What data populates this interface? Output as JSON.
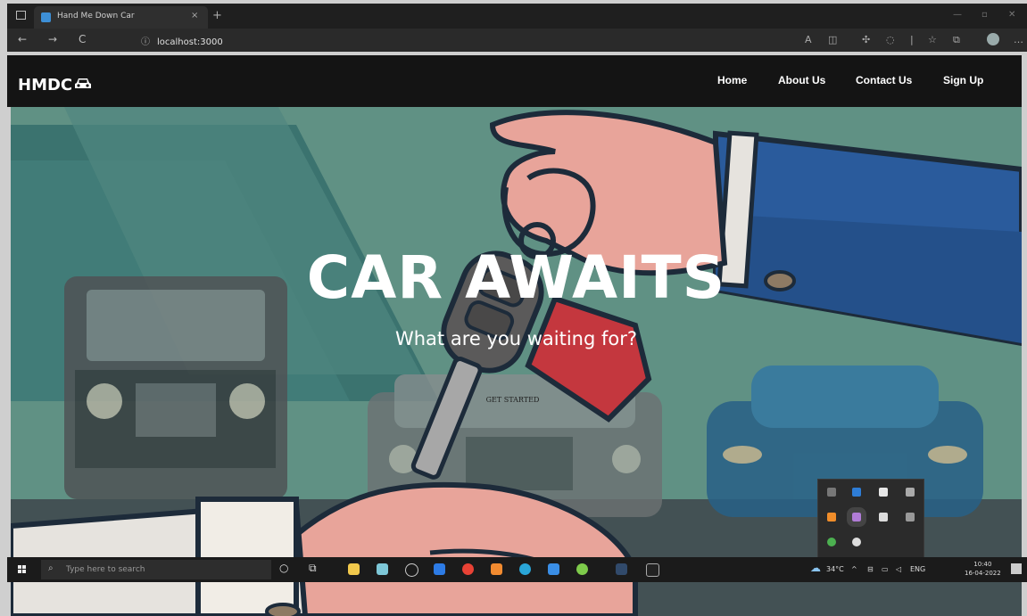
{
  "browser": {
    "tab_title": "Hand Me Down Car",
    "tab_close": "×",
    "new_tab": "+",
    "back": "←",
    "forward": "→",
    "refresh": "C",
    "url_info": "ⓘ",
    "url": "localhost:3000"
  },
  "site": {
    "brand": "HMDC",
    "brand_icon": "car-icon",
    "nav": [
      "Home",
      "About Us",
      "Contact Us",
      "Sign Up"
    ]
  },
  "hero": {
    "title": "CAR AWAITS",
    "subtitle": "What are you waiting for?",
    "cta": "GET STARTED"
  },
  "taskbar": {
    "search_placeholder": "Type here to search",
    "weather": "34°C",
    "language": "ENG",
    "time": "10:40",
    "date": "16-04-2022"
  },
  "colors": {
    "nav_bg": "#141414",
    "hero_bg": "#6fa699",
    "card_red": "#c4373e",
    "sleeve_blue": "#2a5b9c",
    "skin": "#e8a49a"
  }
}
